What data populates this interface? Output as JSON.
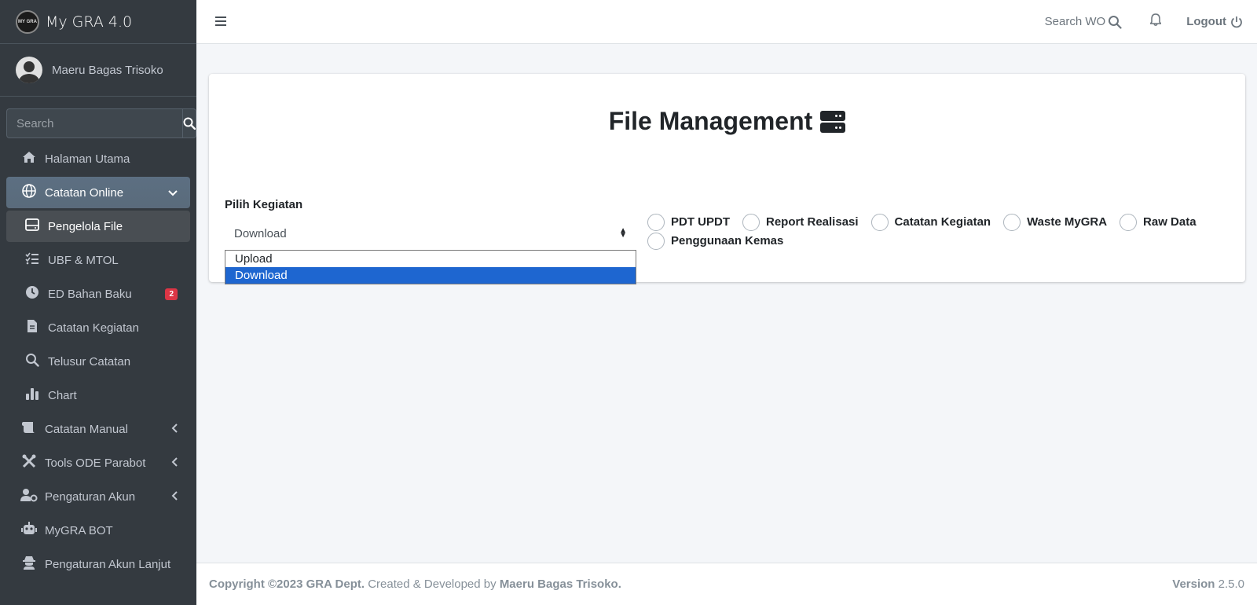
{
  "brand": {
    "logo_text": "MY GRA",
    "title": "My GRA 4.0"
  },
  "user": {
    "name": "Maeru Bagas Trisoko"
  },
  "sidebar_search": {
    "placeholder": "Search"
  },
  "nav": {
    "halaman_utama": "Halaman Utama",
    "catatan_online": "Catatan Online",
    "pengelola_file": "Pengelola File",
    "ubf_mtol": "UBF & MTOL",
    "ed_bahan_baku": "ED Bahan Baku",
    "ed_badge": "2",
    "catatan_kegiatan": "Catatan Kegiatan",
    "telusur_catatan": "Telusur Catatan",
    "chart": "Chart",
    "catatan_manual": "Catatan Manual",
    "tools_ode": "Tools ODE Parabot",
    "pengaturan_akun": "Pengaturan Akun",
    "mygra_bot": "MyGRA BOT",
    "pengaturan_lanjut": "Pengaturan Akun Lanjut"
  },
  "topbar": {
    "search_label": "Search WO",
    "logout_label": "Logout"
  },
  "main": {
    "title": "File Management",
    "form_label": "Pilih Kegiatan",
    "select_value": "Download",
    "options": [
      "Upload",
      "Download"
    ],
    "radios": [
      "PDT UPDT",
      "Report Realisasi",
      "Catatan Kegiatan",
      "Waste MyGRA",
      "Raw Data",
      "Penggunaan Kemas"
    ]
  },
  "footer": {
    "copyright": "Copyright ©2023 GRA Dept.",
    "created": " Created & Developed by ",
    "author": "Maeru Bagas Trisoko.",
    "version_label": "Version",
    "version": " 2.5.0"
  },
  "colors": {
    "sidebar": "#343a40",
    "selected_option": "#1e66d0",
    "badge": "#dc3545"
  }
}
